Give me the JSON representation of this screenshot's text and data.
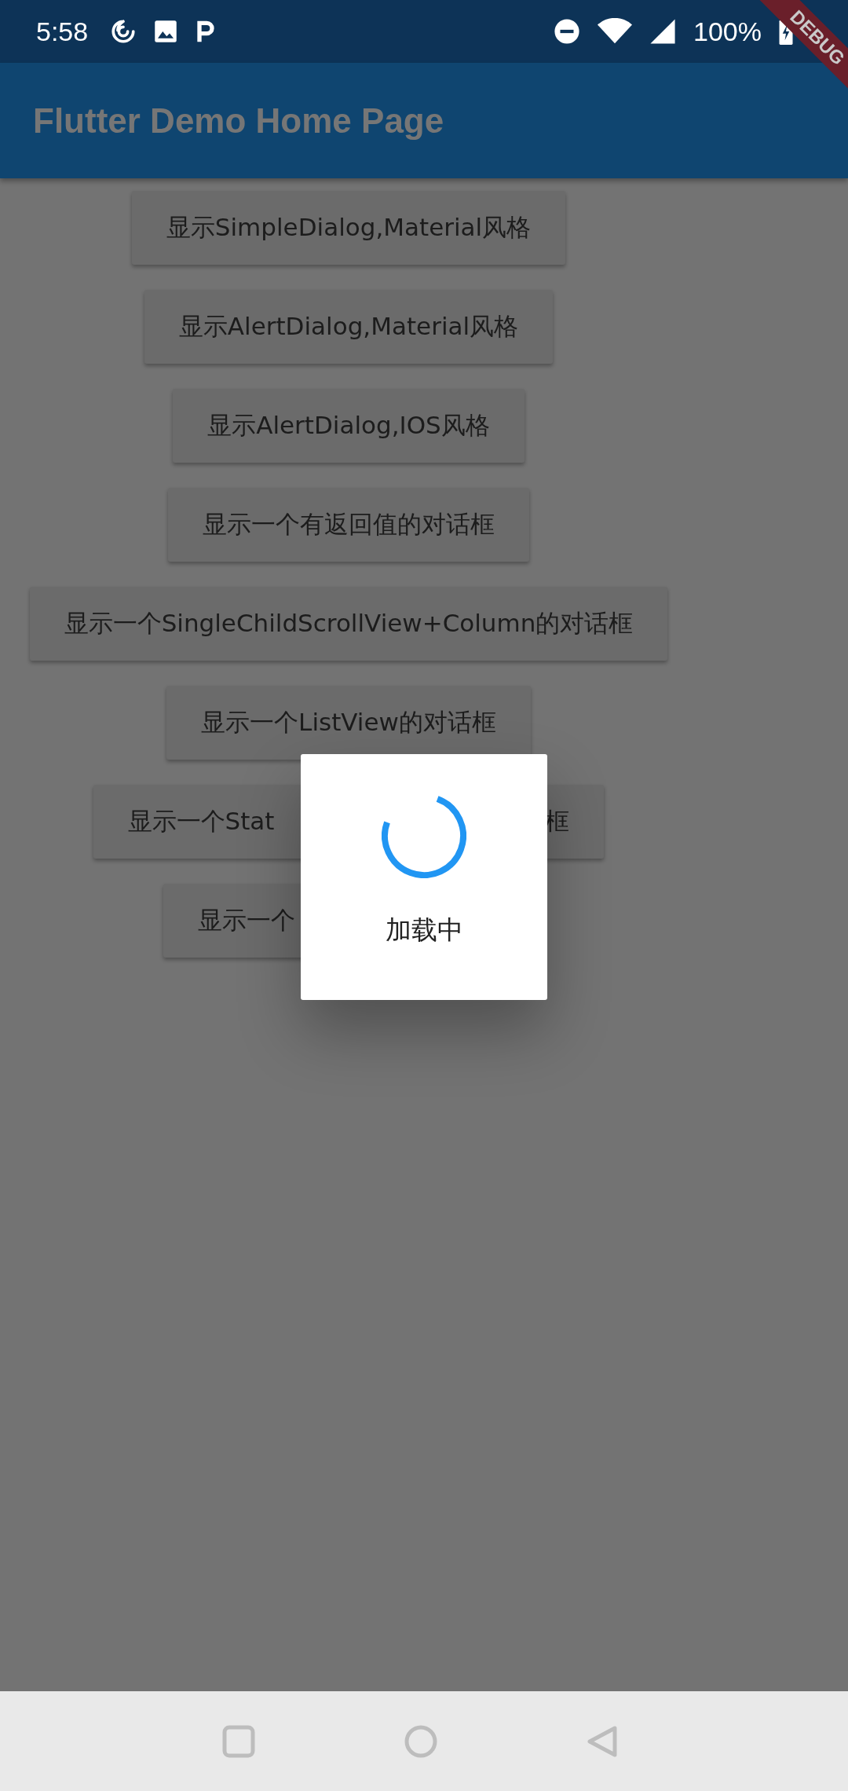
{
  "status_bar": {
    "time": "5:58",
    "battery": "100%"
  },
  "app_bar": {
    "title": "Flutter Demo Home Page"
  },
  "debug_banner": "DEBUG",
  "buttons": [
    {
      "label": "显示SimpleDialog,Material风格",
      "covered": false
    },
    {
      "label": "显示AlertDialog,Material风格",
      "covered": false
    },
    {
      "label": "显示AlertDialog,IOS风格",
      "covered": false
    },
    {
      "label": "显示一个有返回值的对话框",
      "covered": false
    },
    {
      "label": "显示一个SingleChildScrollView+Column的对话框",
      "covered": false
    },
    {
      "label": "显示一个ListView的对话框",
      "covered": false
    },
    {
      "label": "显示一个Stat",
      "tail": "框",
      "covered": true
    },
    {
      "label": "显示一个",
      "covered": true
    }
  ],
  "dialog": {
    "message": "加载中"
  }
}
